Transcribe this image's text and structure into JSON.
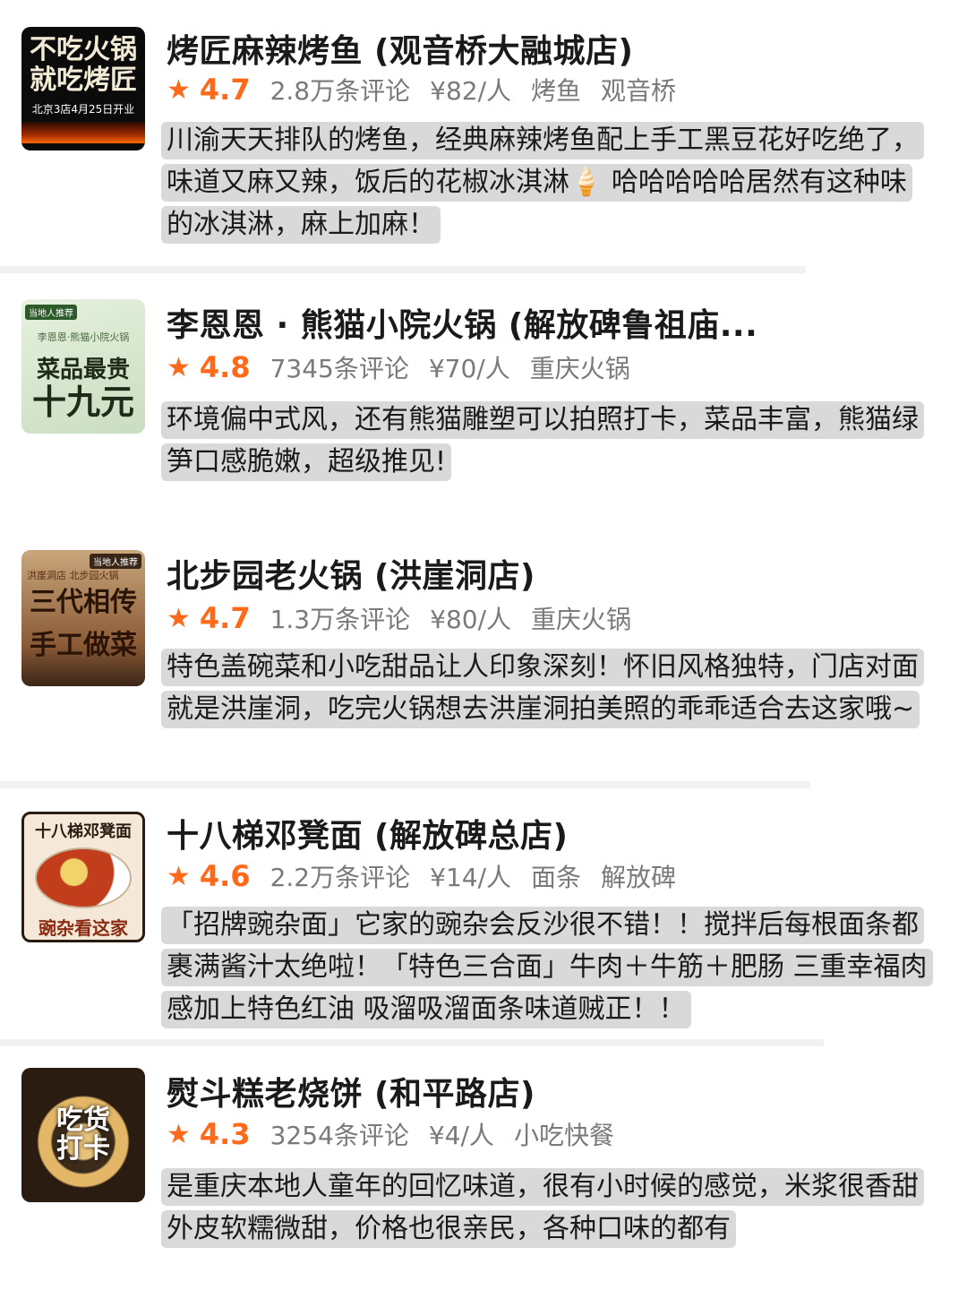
{
  "restaurants": [
    {
      "name": "烤匠麻辣烤鱼 (观音桥大融城店)",
      "rating": "4.7",
      "reviews": "2.8万条评论",
      "price": "¥82/人",
      "tags": [
        "烤鱼",
        "观音桥"
      ],
      "thumb": {
        "line1": "不吃火锅",
        "line2": "就吃烤匠",
        "line3": "北京3店4月25日开业"
      },
      "review_lines": [
        "川渝天天排队的烤鱼，经典麻辣烤鱼配上手工黑豆花好吃绝了，",
        "味道又麻又辣，饭后的花椒冰淇淋🍦 哈哈哈哈哈居然有这种味",
        "的冰淇淋，麻上加麻！"
      ]
    },
    {
      "name": "李恩恩 · 熊猫小院火锅 (解放碑鲁祖庙...",
      "rating": "4.8",
      "reviews": "7345条评论",
      "price": "¥70/人",
      "tags": [
        "重庆火锅"
      ],
      "thumb": {
        "tag": "当地人推荐",
        "small": "李恩恩·熊猫小院火锅",
        "line1": "菜品最贵",
        "line2": "十九元"
      },
      "review_lines": [
        "环境偏中式风，还有熊猫雕塑可以拍照打卡，菜品丰富，熊猫绿",
        "笋口感脆嫩，超级推见!"
      ]
    },
    {
      "name": "北步园老火锅 (洪崖洞店)",
      "rating": "4.7",
      "reviews": "1.3万条评论",
      "price": "¥80/人",
      "tags": [
        "重庆火锅"
      ],
      "thumb": {
        "tag": "当地人推荐",
        "small": "洪崖洞店 北步园火锅",
        "line1": "三代相传",
        "line2": "手工做菜"
      },
      "review_lines": [
        "特色盖碗菜和小吃甜品让人印象深刻！怀旧风格独特，门店对面",
        "就是洪崖洞，吃完火锅想去洪崖洞拍美照的乖乖适合去这家哦~"
      ]
    },
    {
      "name": "十八梯邓凳面 (解放碑总店)",
      "rating": "4.6",
      "reviews": "2.2万条评论",
      "price": "¥14/人",
      "tags": [
        "面条",
        "解放碑"
      ],
      "thumb": {
        "top": "十八梯邓凳面",
        "bottom": "豌杂看这家"
      },
      "review_lines": [
        "「招牌豌杂面」它家的豌杂会反沙很不错！！搅拌后每根面条都",
        "裹满酱汁太绝啦！「特色三合面」牛肉＋牛筋＋肥肠 三重幸福肉",
        "感加上特色红油 吸溜吸溜面条味道贼正！！"
      ]
    },
    {
      "name": "熨斗糕老烧饼 (和平路店)",
      "rating": "4.3",
      "reviews": "3254条评论",
      "price": "¥4/人",
      "tags": [
        "小吃快餐"
      ],
      "thumb": {
        "line1": "吃货",
        "line2": "打卡"
      },
      "review_lines": [
        "是重庆本地人童年的回忆味道，很有小时候的感觉，米浆很香甜",
        "外皮软糯微甜，价格也很亲民，各种口味的都有"
      ]
    }
  ],
  "colors": {
    "accent": "#ff6a1a",
    "highlight": "#d9d9d9",
    "divider": "#f1f1f1"
  }
}
